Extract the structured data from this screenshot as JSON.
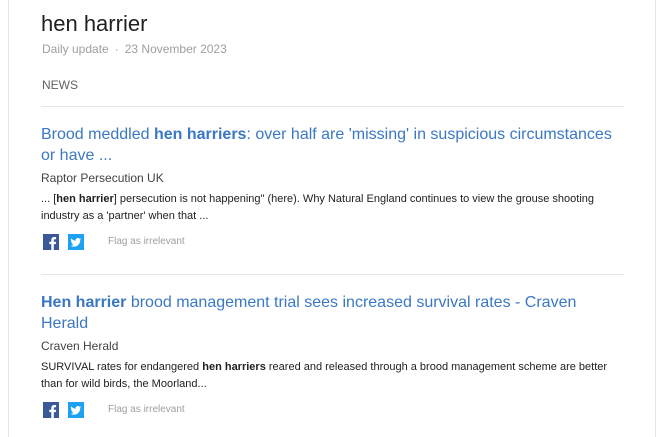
{
  "header": {
    "title": "hen harrier",
    "update_label": "Daily update",
    "separator": "·",
    "date": "23 November 2023"
  },
  "section": {
    "label": "NEWS"
  },
  "articles": [
    {
      "headline_pre": "Brood meddled ",
      "headline_bold": "hen harriers",
      "headline_post": ": over half are 'missing' in suspicious circumstances or have ...",
      "source": "Raptor Persecution UK",
      "snippet_pre": "... [",
      "snippet_bold": "hen harrier",
      "snippet_post": "] persecution is not happening\" (here). Why Natural England continues to view the grouse shooting industry as a 'partner' when that ...",
      "flag_label": "Flag as irrelevant"
    },
    {
      "headline_pre": "",
      "headline_bold": "Hen harrier",
      "headline_post": " brood management trial sees increased survival rates - Craven Herald",
      "source": "Craven Herald",
      "snippet_pre": "SURVIVAL rates for endangered ",
      "snippet_bold": "hen harriers",
      "snippet_post": " reared and released through a brood management scheme are better than for wild birds, the Moorland...",
      "flag_label": "Flag as irrelevant"
    }
  ],
  "colors": {
    "link": "#3b78c3",
    "facebook": "#3b5998",
    "twitter": "#1da1f2"
  },
  "icons": [
    "facebook-icon",
    "twitter-icon"
  ]
}
